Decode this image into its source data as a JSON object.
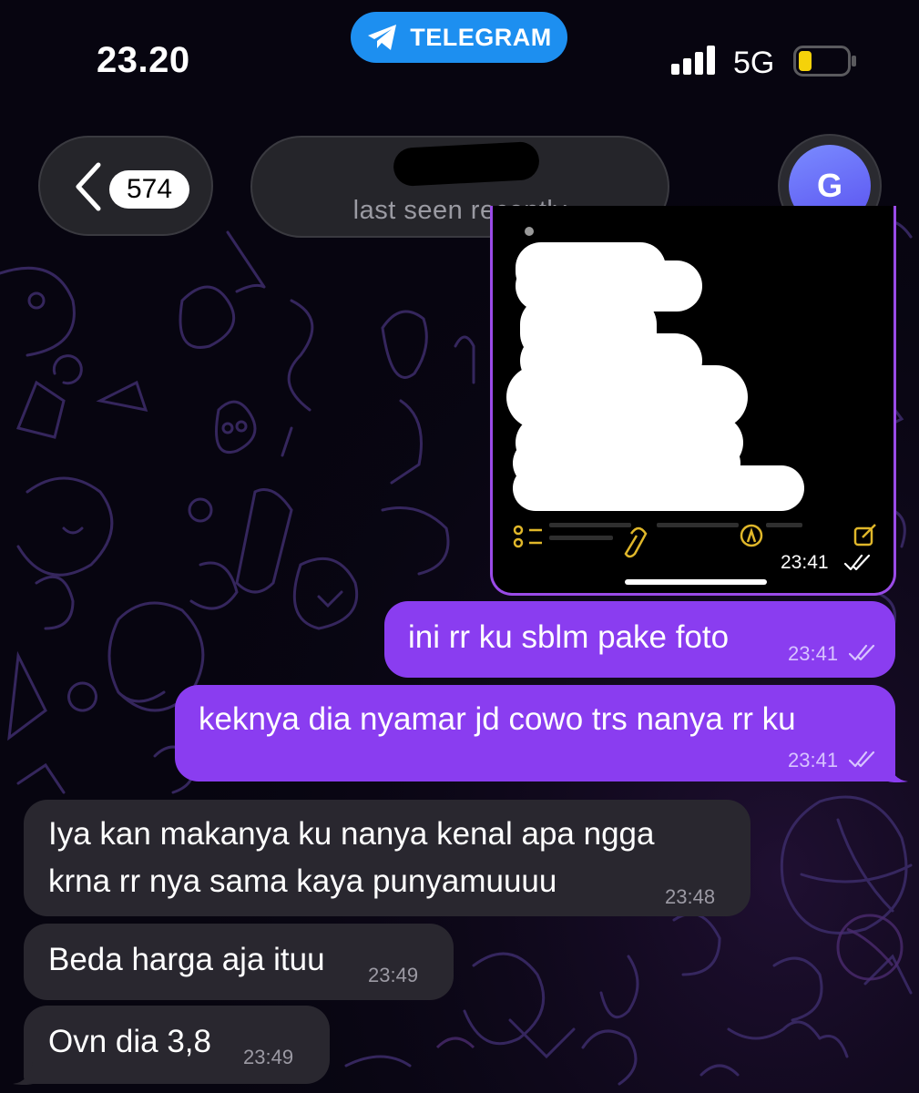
{
  "status_bar": {
    "time": "23.20",
    "source_label": "TELEGRAM",
    "network": "5G",
    "signal_icon": "signal-bars-icon",
    "battery_icon": "battery-low-icon",
    "battery_color": "#f5d20a"
  },
  "header": {
    "unread_count": "574",
    "status": "last seen recently",
    "avatar_letter": "G"
  },
  "colors": {
    "outgoing_bubble": "#8a3df0",
    "incoming_bubble": "#29272f",
    "accent": "#1d8ff0"
  },
  "messages": [
    {
      "direction": "out",
      "type": "photo",
      "time": "23:41",
      "read": true
    },
    {
      "direction": "out",
      "lines": [
        "ini rr ku sblm pake foto"
      ],
      "time": "23:41",
      "read": true
    },
    {
      "direction": "out",
      "lines": [
        "keknya dia nyamar jd cowo trs nanya rr ku"
      ],
      "time": "23:41",
      "read": true
    },
    {
      "direction": "in",
      "lines": [
        "Iya kan makanya ku nanya kenal apa ngga",
        "krna rr nya sama kaya punyamuuuu"
      ],
      "time": "23:48"
    },
    {
      "direction": "in",
      "lines": [
        "Beda harga aja ituu"
      ],
      "time": "23:49"
    },
    {
      "direction": "in",
      "lines": [
        "Ovn dia 3,8"
      ],
      "time": "23:49"
    }
  ]
}
